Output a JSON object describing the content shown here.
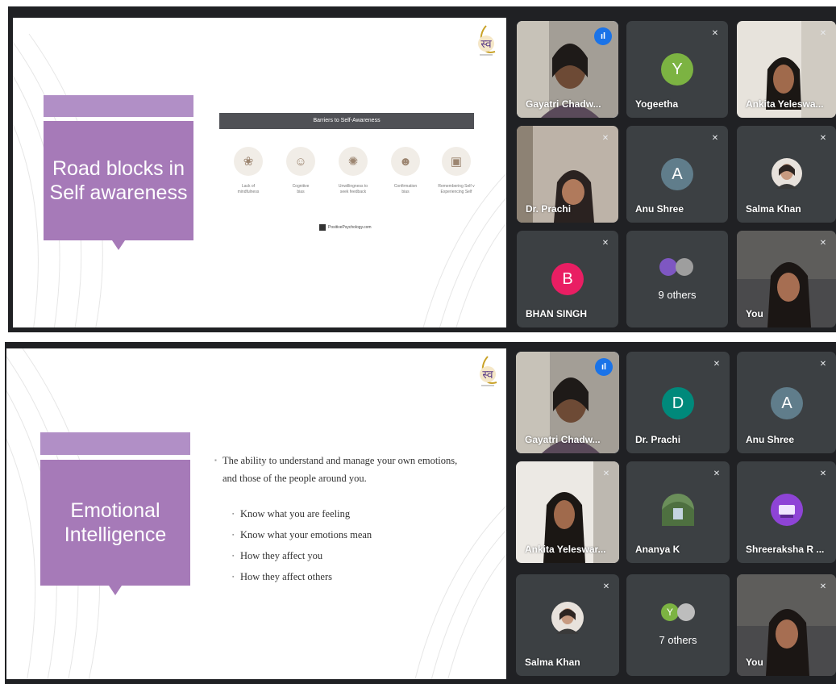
{
  "shot1": {
    "slide": {
      "title_line1": "Road blocks in",
      "title_line2": "Self awareness",
      "infographic_title": "Barriers to Self-Awareness",
      "barriers": [
        {
          "label_line1": "Lack of",
          "label_line2": "mindfulness"
        },
        {
          "label_line1": "Cognitive",
          "label_line2": "bias"
        },
        {
          "label_line1": "Unwillingness to",
          "label_line2": "seek feedback"
        },
        {
          "label_line1": "Confirmation",
          "label_line2": "bias"
        },
        {
          "label_line1": "Remembering Self v",
          "label_line2": "Experiencing Self"
        }
      ],
      "credit": "PositivePsychology.com"
    },
    "tiles": [
      {
        "name": "Gayatri Chadw...",
        "kind": "video",
        "speaking": true
      },
      {
        "name": "Yogeetha",
        "kind": "avatar",
        "initial": "Y",
        "color": "#7cb342"
      },
      {
        "name": "Ankita Yeleswa...",
        "kind": "video"
      },
      {
        "name": "Dr. Prachi",
        "kind": "video"
      },
      {
        "name": "Anu Shree",
        "kind": "avatar",
        "initial": "A",
        "color": "#607d8b"
      },
      {
        "name": "Salma Khan",
        "kind": "photo"
      },
      {
        "name": "BHAN SINGH",
        "kind": "avatar",
        "initial": "B",
        "color": "#e91e63"
      },
      {
        "name": "9 others",
        "kind": "others"
      },
      {
        "name": "You",
        "kind": "video"
      }
    ]
  },
  "shot2": {
    "slide": {
      "title_line1": "Emotional",
      "title_line2": "Intelligence",
      "lead": "The ability to understand and manage your own emotions, and those of the people around you.",
      "bullets": [
        "Know what you are feeling",
        "Know what your emotions mean",
        "How they affect you",
        "How they affect others"
      ]
    },
    "tiles": [
      {
        "name": "Gayatri Chadw...",
        "kind": "video",
        "speaking": true
      },
      {
        "name": "Dr. Prachi",
        "kind": "avatar",
        "initial": "D",
        "color": "#00897b"
      },
      {
        "name": "Anu Shree",
        "kind": "avatar",
        "initial": "A",
        "color": "#607d8b"
      },
      {
        "name": "Ankita Yeleswar...",
        "kind": "video"
      },
      {
        "name": "Ananya K",
        "kind": "photo"
      },
      {
        "name": "Shreeraksha R ...",
        "kind": "photo"
      },
      {
        "name": "Salma Khan",
        "kind": "photo"
      },
      {
        "name": "7 others",
        "kind": "others"
      },
      {
        "name": "You",
        "kind": "video"
      }
    ]
  },
  "icons": {
    "mic_off": "mic-off-icon",
    "speaking": "speaking-indicator-icon"
  },
  "colors": {
    "meet_background": "#202124",
    "tile_background": "#3c4043",
    "active_speaker_border": "#8ab4f8",
    "slide_title_box": "#a67ab8"
  }
}
